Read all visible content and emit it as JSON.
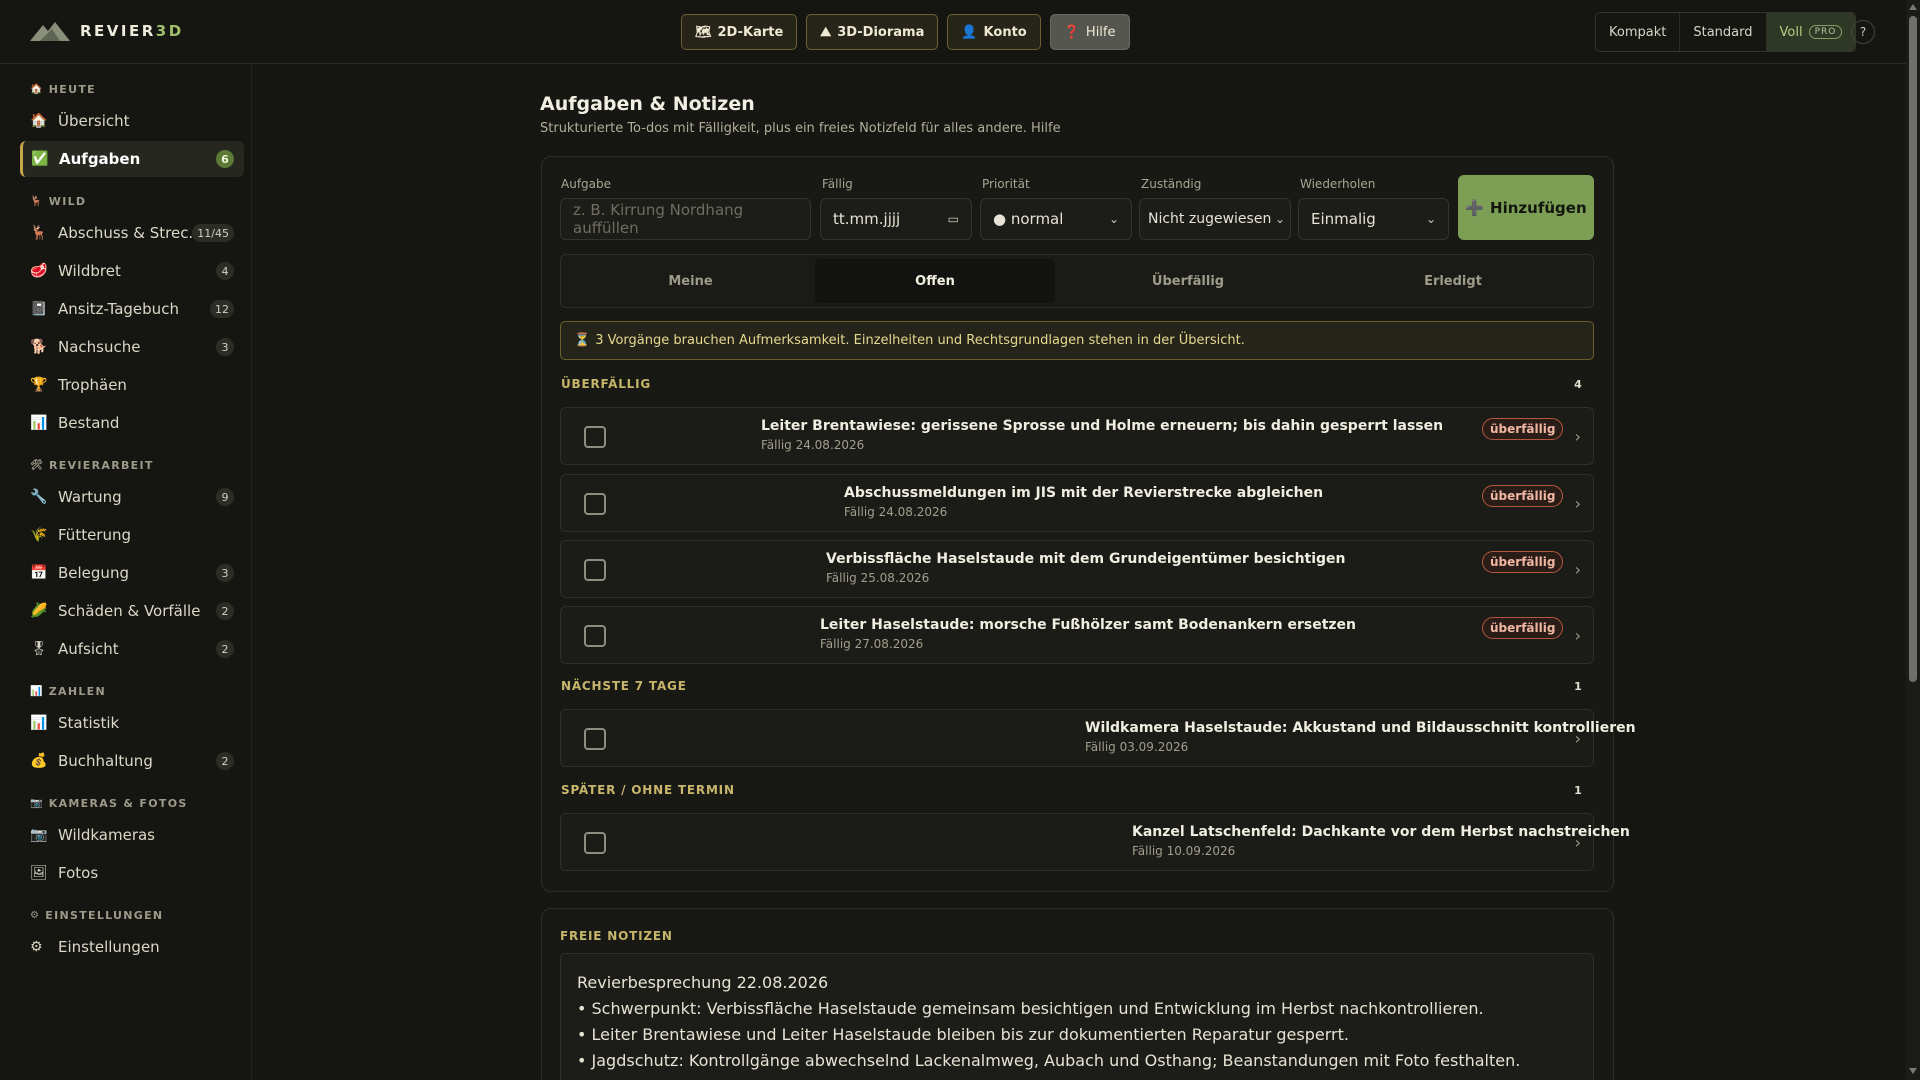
{
  "app": {
    "name_main": "REVIER",
    "name_accent": "3D"
  },
  "topnav": [
    {
      "label": "2D-Karte",
      "icon": "🗺"
    },
    {
      "label": "3D-Diorama",
      "icon": "⛰"
    },
    {
      "label": "Konto",
      "icon": "👤"
    },
    {
      "label": "Hilfe",
      "icon": "❓"
    }
  ],
  "mode": {
    "kompakt": "Kompakt",
    "standard": "Standard",
    "voll": "Voll",
    "pro": "PRO"
  },
  "help_btn": "?",
  "sidebar": {
    "sections": [
      {
        "title": "HEUTE",
        "icon": "🏠"
      },
      {
        "title": "WILD",
        "icon": "🦌"
      },
      {
        "title": "REVIERARBEIT",
        "icon": "🛠"
      },
      {
        "title": "ZAHLEN",
        "icon": "📊"
      },
      {
        "title": "KAMERAS & FOTOS",
        "icon": "📷"
      },
      {
        "title": "EINSTELLUNGEN",
        "icon": "⚙"
      }
    ],
    "items": [
      {
        "label": "Übersicht",
        "icon": "🏠",
        "badge": ""
      },
      {
        "label": "Aufgaben",
        "icon": "✅",
        "badge": "6"
      },
      {
        "label": "Abschuss & Strec...",
        "icon": "🦌",
        "badge": "11/45"
      },
      {
        "label": "Wildbret",
        "icon": "🥩",
        "badge": "4"
      },
      {
        "label": "Ansitz-Tagebuch",
        "icon": "📓",
        "badge": "12"
      },
      {
        "label": "Nachsuche",
        "icon": "🐕",
        "badge": "3"
      },
      {
        "label": "Trophäen",
        "icon": "🏆",
        "badge": ""
      },
      {
        "label": "Bestand",
        "icon": "📊",
        "badge": ""
      },
      {
        "label": "Wartung",
        "icon": "🔧",
        "badge": "9"
      },
      {
        "label": "Fütterung",
        "icon": "🌾",
        "badge": ""
      },
      {
        "label": "Belegung",
        "icon": "📅",
        "badge": "3"
      },
      {
        "label": "Schäden & Vorfälle",
        "icon": "🌽",
        "badge": "2"
      },
      {
        "label": "Aufsicht",
        "icon": "🎖",
        "badge": "2"
      },
      {
        "label": "Statistik",
        "icon": "📊",
        "badge": ""
      },
      {
        "label": "Buchhaltung",
        "icon": "💰",
        "badge": "2"
      },
      {
        "label": "Wildkameras",
        "icon": "📷",
        "badge": ""
      },
      {
        "label": "Fotos",
        "icon": "🖼",
        "badge": ""
      },
      {
        "label": "Einstellungen",
        "icon": "⚙",
        "badge": ""
      }
    ]
  },
  "page": {
    "title": "Aufgaben & Notizen",
    "subtitle": "Strukturierte To-dos mit Fälligkeit, plus ein freies Notizfeld für alles andere. Hilfe"
  },
  "form": {
    "task_label": "Aufgabe",
    "task_placeholder": "z. B. Kirrung Nordhang auffüllen",
    "due_label": "Fällig",
    "due_value": "tt.mm.jjjj",
    "prio_label": "Priorität",
    "prio_value": "● normal",
    "assignee_label": "Zuständig",
    "assignee_value": "Nicht zugewiesen",
    "repeat_label": "Wiederholen",
    "repeat_value": "Einmalig",
    "add_label": "Hinzufügen",
    "add_icon": "➕"
  },
  "tabs": [
    "Meine",
    "Offen",
    "Überfällig",
    "Erledigt"
  ],
  "active_tab": "Offen",
  "notice": {
    "icon": "⏳",
    "text": "3 Vorgänge brauchen Aufmerksamkeit. Einzelheiten und Rechtsgrundlagen stehen in der Übersicht."
  },
  "groups": [
    {
      "title": "ÜBERFÄLLIG",
      "count": "4"
    },
    {
      "title": "NÄCHSTE 7 TAGE",
      "count": "1"
    },
    {
      "title": "SPÄTER / OHNE TERMIN",
      "count": "1"
    }
  ],
  "tasks": [
    {
      "title": "Leiter Brentawiese: gerissene Sprosse und Holme erneuern; bis dahin gesperrt lassen",
      "due": "Fällig 24.08.2026",
      "badge": "überfällig"
    },
    {
      "title": "Abschussmeldungen im JIS mit der Revierstrecke abgleichen",
      "due": "Fällig 24.08.2026",
      "badge": "überfällig"
    },
    {
      "title": "Verbissfläche Haselstaude mit dem Grundeigentümer besichtigen",
      "due": "Fällig 25.08.2026",
      "badge": "überfällig"
    },
    {
      "title": "Leiter Haselstaude: morsche Fußhölzer samt Bodenankern ersetzen",
      "due": "Fällig 27.08.2026",
      "badge": "überfällig"
    },
    {
      "title": "Wildkamera Haselstaude: Akkustand und Bildausschnitt kontrollieren",
      "due": "Fällig 03.09.2026",
      "badge": ""
    },
    {
      "title": "Kanzel Latschenfeld: Dachkante vor dem Herbst nachstreichen",
      "due": "Fällig 10.09.2026",
      "badge": ""
    }
  ],
  "notes": {
    "title": "FREIE NOTIZEN",
    "lines": [
      "Revierbesprechung 22.08.2026",
      "• Schwerpunkt: Verbissfläche Haselstaude gemeinsam besichtigen und Entwicklung im Herbst nachkontrollieren.",
      "• Leiter Brentawiese und Leiter Haselstaude bleiben bis zur dokumentierten Reparatur gesperrt.",
      "• Jagdschutz: Kontrollgänge abwechselnd Lackenalmweg, Aubach und Osthang; Beanstandungen mit Foto festhalten."
    ]
  }
}
